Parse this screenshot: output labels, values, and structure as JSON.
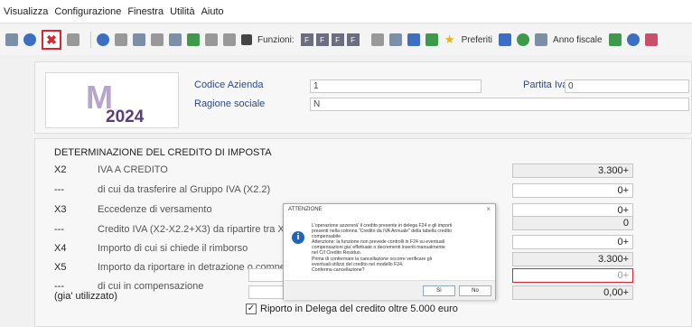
{
  "menu": [
    "Visualizza",
    "Configurazione",
    "Finestra",
    "Utilità",
    "Aiuto"
  ],
  "toolbar": {
    "funzioni_label": "Funzioni:",
    "funzioni_keys": [
      "F",
      "F",
      "F",
      "F"
    ],
    "preferiti_label": "Preferiti",
    "anno_fiscale_label": "Anno fiscale"
  },
  "logo": {
    "mark": "M",
    "year": "2024"
  },
  "header": {
    "codice_azienda_label": "Codice Azienda",
    "codice_azienda_value": "1",
    "ragione_sociale_label": "Ragione sociale",
    "ragione_sociale_value": "N",
    "partita_iva_label": "Partita Iva",
    "partita_iva_value": "0"
  },
  "section_title": "DETERMINAZIONE DEL CREDITO DI IMPOSTA",
  "rows": [
    {
      "code": "X2",
      "desc": "IVA A CREDITO",
      "value": "3.300+"
    },
    {
      "code": "---",
      "desc": "di cui da trasferire al Gruppo IVA  (X2.2)",
      "value": "0+"
    },
    {
      "code": "X3",
      "desc": "Eccedenze di versamento",
      "value": "0+"
    },
    {
      "code": "---",
      "desc": "Credito IVA (X2-X2.2+X3) da ripartire tra X4 e X5",
      "value": "0"
    },
    {
      "code": "X4",
      "desc": "Importo di cui si chiede il rimborso",
      "value": "0+"
    },
    {
      "code": "X5",
      "desc": "Importo da riportare in detrazione o compensazione",
      "value": "3.300+"
    },
    {
      "code": "---",
      "desc": "di cui in compensazione",
      "value": "0+"
    },
    {
      "code": "(gia' utilizzato)",
      "desc": "",
      "value": "0,00+"
    }
  ],
  "checkbox": {
    "label": "Riporto in Delega del credito oltre 5.000 euro",
    "checked": true,
    "mark": "✓"
  },
  "dialog": {
    "title": "ATTENZIONE",
    "close": "×",
    "icon_glyph": "i",
    "message": [
      "L'operazione azzererà' il credito presente in delega F24 e gli importi",
      "presenti nella colonna \"Credito da IVA Annuale\" della tabella credito",
      "compensabile.",
      "Attenzione: la funzione non prevede controlli in F24 su eventuali",
      "compensazioni gia' effettuate o decrementi inseriti manualmente",
      "nel C/I Credito Residuo.",
      "Prima di confermare la cancellazione occorre verificare gli",
      "eventuali utilizzi del credito nel modello F24.",
      "Conferma cancellazione?"
    ],
    "yes_label": "Sì",
    "no_label": "No"
  },
  "colors": {
    "accent_red": "#d9262f",
    "label_blue": "#2a4a8a",
    "logo_purple": "#5a3d7a"
  }
}
